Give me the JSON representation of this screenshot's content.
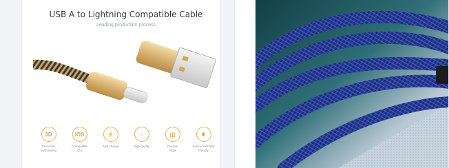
{
  "left_card": {
    "title": "USB A to Lightning Compatible Cable",
    "subtitle": "Leading production process",
    "features": [
      {
        "icon_text": "3D",
        "icon": "3d-icon",
        "line1": "Precision",
        "line2": "gold plating"
      },
      {
        "icon_text": "iOS",
        "icon": "ios-icon",
        "line1": "Compatible",
        "line2": "iOS"
      },
      {
        "icon_text": "⚡",
        "icon": "lightning-icon",
        "line1": "Fast charge",
        "line2": ""
      },
      {
        "icon_text": "⌂",
        "icon": "quality-icon",
        "line1": "High quality",
        "line2": ""
      },
      {
        "icon_text": "◫",
        "icon": "angle-icon",
        "line1": "Custom",
        "line2": "Angle"
      },
      {
        "icon_text": "❦",
        "icon": "leaf-icon",
        "line1": "Environmentally",
        "line2": "friendly"
      }
    ]
  },
  "colors": {
    "gold": "#d9a445",
    "cable_blue": "#2a3f9a",
    "background": "#f3f4f7"
  }
}
